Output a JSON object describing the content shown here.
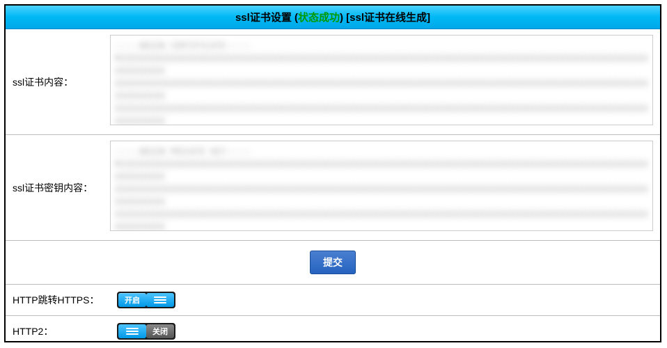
{
  "header": {
    "title_prefix": "ssl证书设置 (",
    "status": "状态成功",
    "title_mid": ") [",
    "link": "ssl证书在线生成",
    "title_suffix": "]"
  },
  "cert_content": {
    "label": "ssl证书内容：",
    "value": "-----BEGIN CERTIFICATE-----\nMIIEXXXXXXXXXXXXXXXXXXXXXXXXXXXXXXXXXXXXXXXXXXXXXXXXXXXXXXXXXXXXXXXXXXXXXXXXXXXXXXXXXXXXXXXXXXXXXXXXXXXXXXXXXXXXXXXX\nXXXXXXXXXXXXXXXXXXXXXXXXXXXXXXXXXXXXXXXXXXXXXXXXXXXXXXXXXXXXXXXXXXXXXXXXXXXXXXXXXXXXXXXXXXXXXXXXXXXXXXXXXXXXXXXXXXXX\nXXXXXXXXXXXXXXXXXXXXXXXXXXXXXXXXXXXXXXXXXXXXXXXXXXXXXXXXXXXXXXXXXXXXXXXXXXXXXXXXXXXXXXXXXXXXXXXXXXXXXXXXXXXXXXXXXXXX\nXXXXXXXXXXXXXXXXXXXXXXXXXXXXXXXXXXXXXXXXXXXXXXXXXXXXXXXXXXXXXXXXXXXXXXXXXXXXXXXXXXXXXXXXXXXXXXXXXXXXXXXXXXXXXXXXXXXX\nXXXXXXXXXXXXXXXXXXXXXXXXXXXXXXXXXXXXXXXXXXXXXXXXXXXXXXXXXXXXXXXXXXXXXXXXXXXXXXXXXXXXXXXXXXXXXXXXXXXXXXXXXXXXXXXXXXXX"
  },
  "key_content": {
    "label": "ssl证书密钥内容：",
    "value": "-----BEGIN PRIVATE KEY-----\nMIIEXXXXXXXXXXXXXXXXXXXXXXXXXXXXXXXXXXXXXXXXXXXXXXXXXXXXXXXXXXXXXXXXXXXXXXXXXXXXXXXXXXXXXXXXXXXXXXXXXXXXXXXXXXXXXXXX\nXXXXXXXXXXXXXXXXXXXXXXXXXXXXXXXXXXXXXXXXXXXXXXXXXXXXXXXXXXXXXXXXXXXXXXXXXXXXXXXXXXXXXXXXXXXXXXXXXXXXXXXXXXXXXXXXXXXX\nXXXXXXXXXXXXXXXXXXXXXXXXXXXXXXXXXXXXXXXXXXXXXXXXXXXXXXXXXXXXXXXXXXXXXXXXXXXXXXXXXXXXXXXXXXXXXXXXXXXXXXXXXXXXXXXXXXXX\nXXXXXXXXXXXXXXXXXXXXXXXXXXXXXXXXXXXXXXXXXXXXXXXXXXXXXXXXXXXXXXXXXXXXXXXXXXXXXXXXXXXXXXXXXXXXXXXXXXXXXXXXXXXXXXXXXXXX\nXXXXXXXXXXXXXXXXXXXXXXXXXXXXXXXXXXXXXXXXXXXXXXXXXXXXXXXXXXXXXXXXXXXXXXXXXXXXXXXXXXXXXXXXXXXXXXXXXXXXXXXXXXXXXXXXXXXX"
  },
  "submit": {
    "label": "提交"
  },
  "http_redirect": {
    "label": "HTTP跳转HTTPS：",
    "on_text": "开启",
    "state": "on"
  },
  "http2": {
    "label": "HTTP2：",
    "off_text": "关闭",
    "state": "off"
  }
}
